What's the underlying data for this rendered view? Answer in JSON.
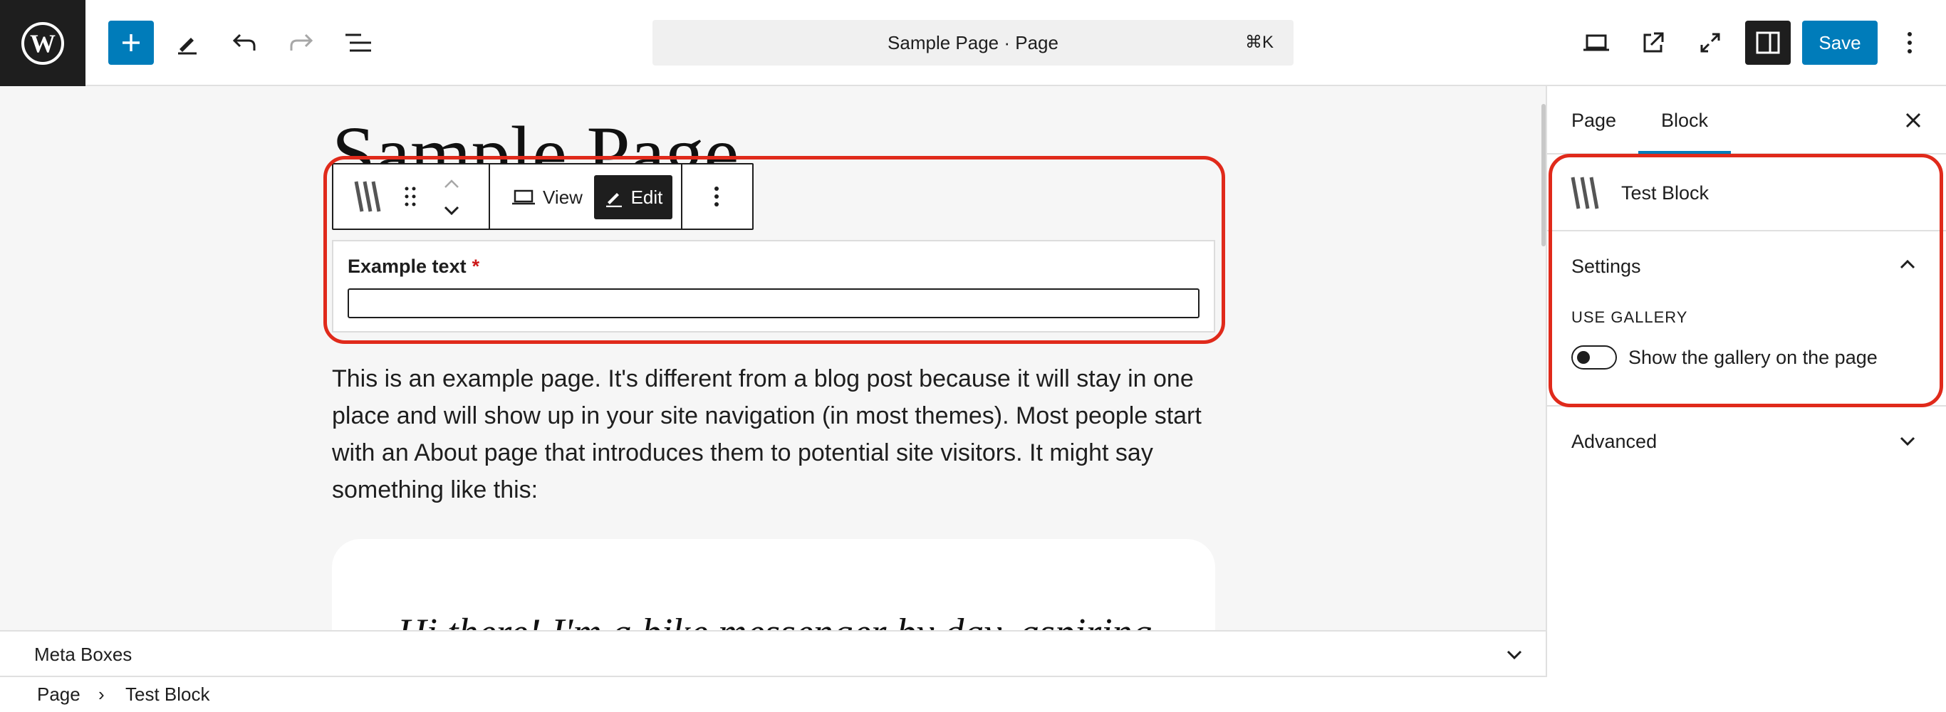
{
  "header": {
    "command_bar": {
      "title": "Sample Page · Page",
      "shortcut": "⌘K"
    },
    "save_label": "Save"
  },
  "canvas": {
    "page_title": "Sample Page",
    "block_toolbar": {
      "view_label": "View",
      "edit_label": "Edit"
    },
    "field": {
      "label": "Example text",
      "required_mark": "*",
      "value": ""
    },
    "body_text": "This is an example page. It's different from a blog post because it will stay in one place and will show up in your site navigation (in most themes). Most people start with an About page that introduces them to potential site visitors. It might say something like this:",
    "quote": "Hi there! I'm a bike messenger by day, aspiring"
  },
  "meta_boxes": {
    "label": "Meta Boxes"
  },
  "breadcrumb": {
    "items": [
      "Page",
      "Test Block"
    ],
    "separator": "›"
  },
  "sidebar": {
    "tabs": [
      {
        "label": "Page",
        "active": false
      },
      {
        "label": "Block",
        "active": true
      }
    ],
    "block_name": "Test Block",
    "settings": {
      "title": "Settings",
      "expanded": true,
      "section_label": "USE GALLERY",
      "toggle_label": "Show the gallery on the page",
      "toggle_on": false
    },
    "advanced": {
      "title": "Advanced",
      "expanded": false
    }
  },
  "colors": {
    "accent": "#007cba",
    "dark": "#1e1e1e",
    "highlight": "#e02a1b",
    "required": "#cc1818"
  }
}
